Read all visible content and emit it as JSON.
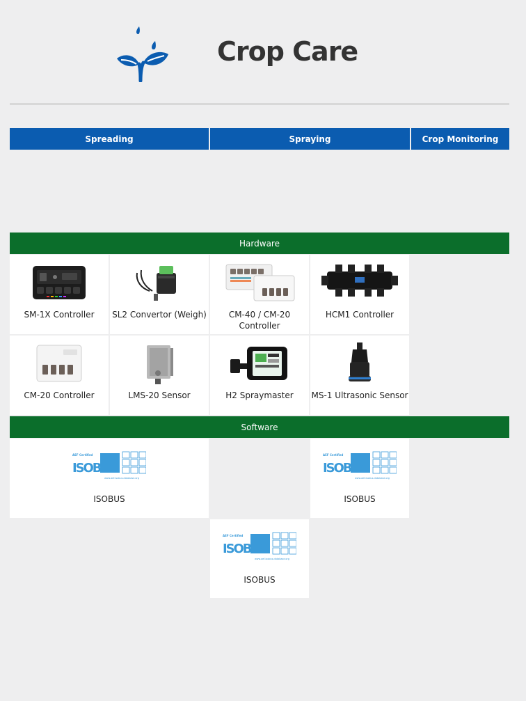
{
  "header": {
    "title": "Crop Care"
  },
  "tabs": [
    {
      "label": "Spreading"
    },
    {
      "label": "Spraying"
    },
    {
      "label": "Crop Monitoring"
    }
  ],
  "hardware": {
    "heading": "Hardware",
    "items": [
      {
        "label": "SM-1X Controller"
      },
      {
        "label": "SL2 Convertor (Weigh)"
      },
      {
        "label": "CM-40 / CM-20 Controller"
      },
      {
        "label": "HCM1 Controller"
      },
      {
        "label": "CM-20 Controller"
      },
      {
        "label": "LMS-20 Sensor"
      },
      {
        "label": "H2 Spraymaster"
      },
      {
        "label": "MS-1 Ultrasonic Sensor"
      }
    ]
  },
  "software": {
    "heading": "Software",
    "items": [
      {
        "label": "ISOBUS"
      },
      {
        "label": "ISOBUS"
      },
      {
        "label": "ISOBUS"
      }
    ],
    "badge": {
      "certified": "AEF Certified",
      "wordmark": "ISOBUS",
      "url": "www.aef-isobus-database.org"
    }
  },
  "colors": {
    "tab_blue": "#0b5cb0",
    "band_green": "#0b6e2b",
    "icon_blue": "#0b5cb0",
    "isobus_blue": "#3a9ad9"
  }
}
